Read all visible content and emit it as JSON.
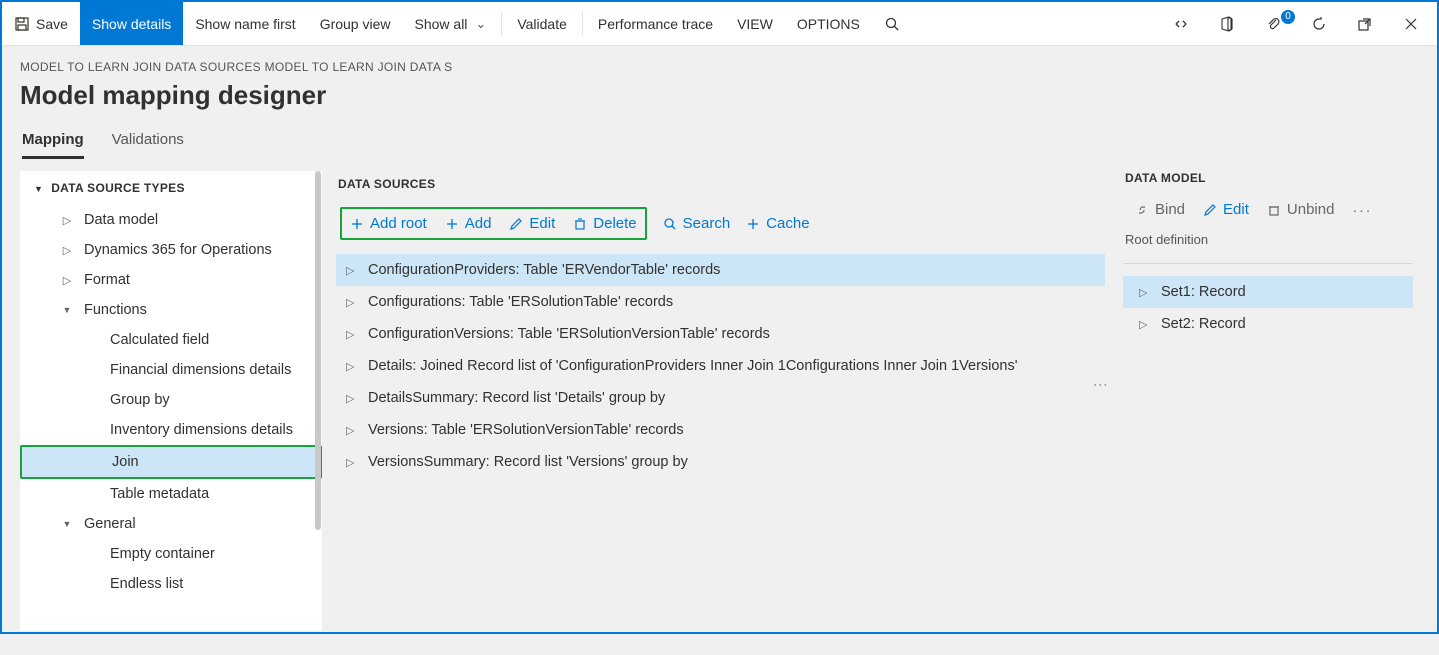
{
  "toolbar": {
    "save": "Save",
    "show_details": "Show details",
    "show_name_first": "Show name first",
    "group_view": "Group view",
    "show_all": "Show all",
    "validate": "Validate",
    "perf_trace": "Performance trace",
    "view": "VIEW",
    "options": "OPTIONS",
    "badge_count": "0"
  },
  "breadcrumb": "MODEL TO LEARN JOIN DATA SOURCES MODEL TO LEARN JOIN DATA S",
  "page_title": "Model mapping designer",
  "tabs": {
    "mapping": "Mapping",
    "validations": "Validations"
  },
  "left": {
    "header": "DATA SOURCE TYPES",
    "items": [
      {
        "label": "Data model",
        "level": 1,
        "caret": "right"
      },
      {
        "label": "Dynamics 365 for Operations",
        "level": 1,
        "caret": "right"
      },
      {
        "label": "Format",
        "level": 1,
        "caret": "right"
      },
      {
        "label": "Functions",
        "level": 1,
        "caret": "down"
      },
      {
        "label": "Calculated field",
        "level": 2,
        "caret": ""
      },
      {
        "label": "Financial dimensions details",
        "level": 2,
        "caret": ""
      },
      {
        "label": "Group by",
        "level": 2,
        "caret": ""
      },
      {
        "label": "Inventory dimensions details",
        "level": 2,
        "caret": ""
      },
      {
        "label": "Join",
        "level": 2,
        "caret": "",
        "selected": true,
        "green": true
      },
      {
        "label": "Table metadata",
        "level": 2,
        "caret": ""
      },
      {
        "label": "General",
        "level": 1,
        "caret": "down"
      },
      {
        "label": "Empty container",
        "level": 2,
        "caret": ""
      },
      {
        "label": "Endless list",
        "level": 2,
        "caret": ""
      }
    ]
  },
  "middle": {
    "header": "DATA SOURCES",
    "toolbar": {
      "add_root": "Add root",
      "add": "Add",
      "edit": "Edit",
      "delete": "Delete",
      "search": "Search",
      "cache": "Cache"
    },
    "items": [
      {
        "label": "ConfigurationProviders: Table 'ERVendorTable' records",
        "selected": true
      },
      {
        "label": "Configurations: Table 'ERSolutionTable' records"
      },
      {
        "label": "ConfigurationVersions: Table 'ERSolutionVersionTable' records"
      },
      {
        "label": "Details: Joined Record list of 'ConfigurationProviders Inner Join 1Configurations Inner Join 1Versions'"
      },
      {
        "label": "DetailsSummary: Record list 'Details' group by"
      },
      {
        "label": "Versions: Table 'ERSolutionVersionTable' records"
      },
      {
        "label": "VersionsSummary: Record list 'Versions' group by"
      }
    ]
  },
  "right": {
    "header": "DATA MODEL",
    "toolbar": {
      "bind": "Bind",
      "edit": "Edit",
      "unbind": "Unbind"
    },
    "root_definition_label": "Root definition",
    "items": [
      {
        "label": "Set1: Record",
        "selected": true
      },
      {
        "label": "Set2: Record"
      }
    ]
  }
}
